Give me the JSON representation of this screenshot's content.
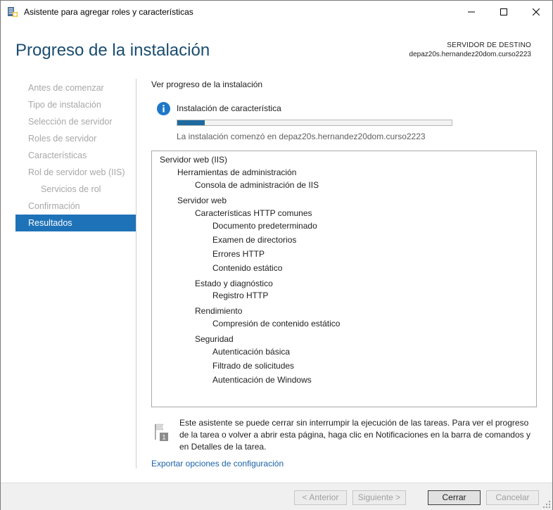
{
  "window": {
    "title": "Asistente para agregar roles y características"
  },
  "header": {
    "page_title": "Progreso de la instalación",
    "destination_label": "SERVIDOR DE DESTINO",
    "destination_server": "depaz20s.hernandez20dom.curso2223"
  },
  "sidebar": {
    "items": [
      {
        "label": "Antes de comenzar",
        "state": "disabled",
        "level": 0
      },
      {
        "label": "Tipo de instalación",
        "state": "disabled",
        "level": 0
      },
      {
        "label": "Selección de servidor",
        "state": "disabled",
        "level": 0
      },
      {
        "label": "Roles de servidor",
        "state": "disabled",
        "level": 0
      },
      {
        "label": "Características",
        "state": "disabled",
        "level": 0
      },
      {
        "label": "Rol de servidor web (IIS)",
        "state": "disabled",
        "level": 0
      },
      {
        "label": "Servicios de rol",
        "state": "disabled",
        "level": 1
      },
      {
        "label": "Confirmación",
        "state": "disabled",
        "level": 0
      },
      {
        "label": "Resultados",
        "state": "active",
        "level": 0
      }
    ]
  },
  "main": {
    "section_heading": "Ver progreso de la instalación",
    "status_text": "Instalación de característica",
    "progress_fraction": 0.1,
    "progress_caption": "La instalación comenzó en depaz20s.hernandez20dom.curso2223",
    "results_tree": [
      {
        "label": "Servidor web (IIS)",
        "level": 0
      },
      {
        "label": "Herramientas de administración",
        "level": 1
      },
      {
        "label": "Consola de administración de IIS",
        "level": 2
      },
      {
        "label": "Servidor web",
        "level": 1
      },
      {
        "label": "Características HTTP comunes",
        "level": 2
      },
      {
        "label": "Documento predeterminado",
        "level": 3
      },
      {
        "label": "Examen de directorios",
        "level": 3
      },
      {
        "label": "Errores HTTP",
        "level": 3
      },
      {
        "label": "Contenido estático",
        "level": 3
      },
      {
        "label": "Estado y diagnóstico",
        "level": 2
      },
      {
        "label": "Registro HTTP",
        "level": 3
      },
      {
        "label": "Rendimiento",
        "level": 2
      },
      {
        "label": "Compresión de contenido estático",
        "level": 3
      },
      {
        "label": "Seguridad",
        "level": 2
      },
      {
        "label": "Autenticación básica",
        "level": 3
      },
      {
        "label": "Filtrado de solicitudes",
        "level": 3
      },
      {
        "label": "Autenticación de Windows",
        "level": 3
      }
    ],
    "notice_text": "Este asistente se puede cerrar sin interrumpir la ejecución de las tareas. Para ver el progreso de la tarea o volver a abrir esta página, haga clic en Notificaciones en la barra de comandos y en Detalles de la tarea.",
    "notice_badge": "1",
    "export_link": "Exportar opciones de configuración"
  },
  "footer": {
    "back_label": "< Anterior",
    "next_label": "Siguiente >",
    "close_label": "Cerrar",
    "cancel_label": "Cancelar"
  },
  "colors": {
    "title_blue": "#1a4d70",
    "active_nav": "#1e72b8",
    "progress_fill": "#1c6a9f",
    "link": "#1a62a8",
    "info_icon": "#1e78c8"
  },
  "icons": {
    "app": "server-manager-icon",
    "info": "info-icon",
    "notice": "flag-icon"
  }
}
